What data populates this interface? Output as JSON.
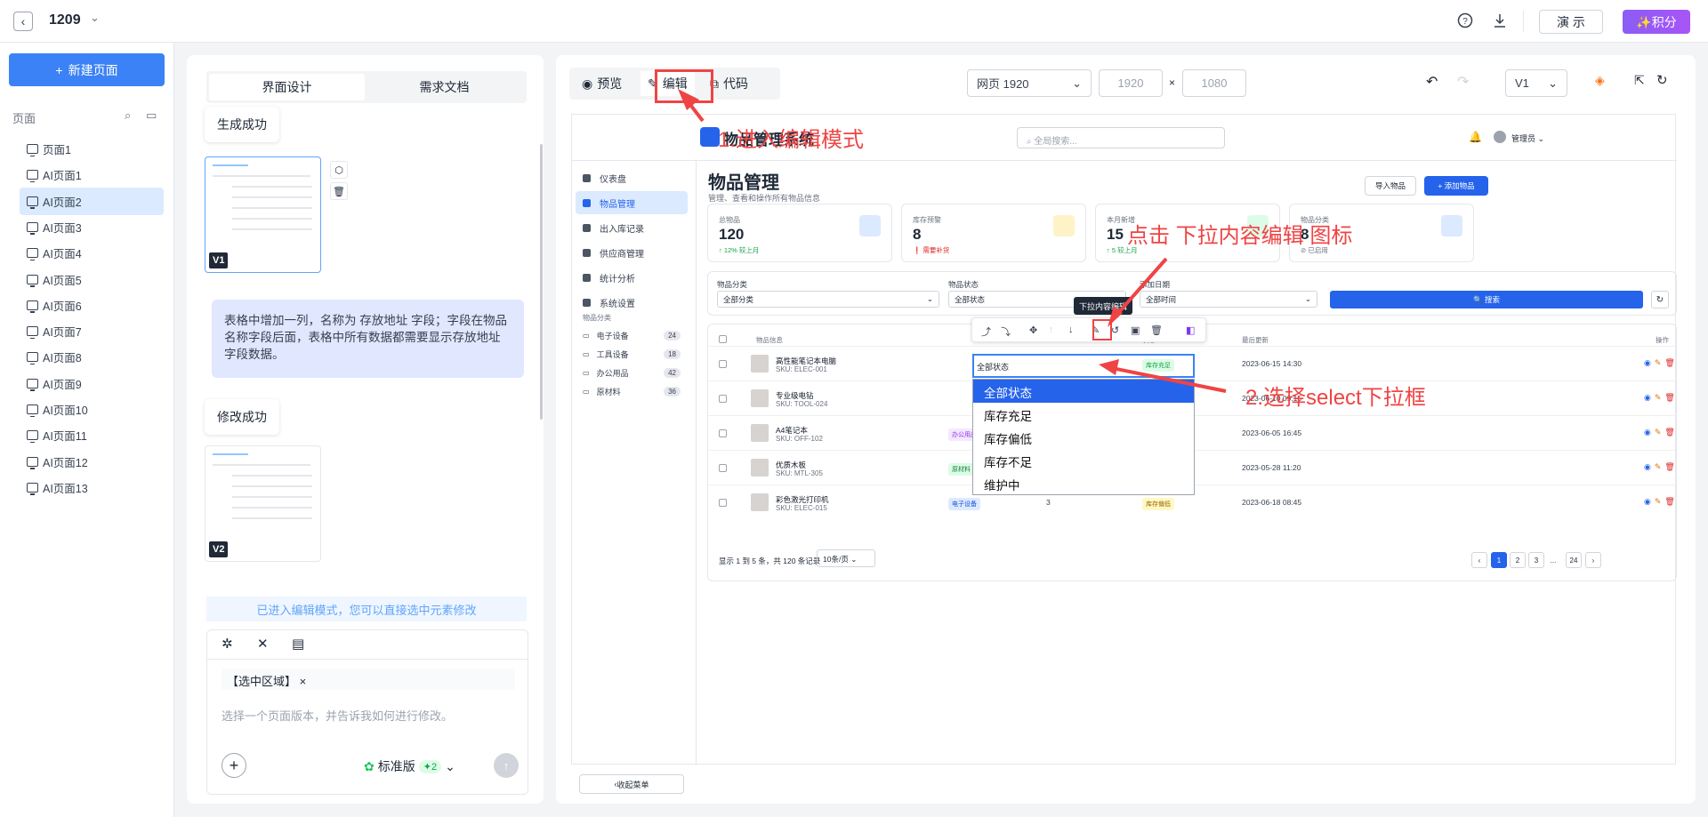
{
  "topbar": {
    "project": "1209",
    "demo": "演 示",
    "points": "✨积分"
  },
  "leftnav": {
    "new_page": "新建页面",
    "section": "页面",
    "pages": [
      "页面1",
      "AI页面1",
      "AI页面2",
      "AI页面3",
      "AI页面4",
      "AI页面5",
      "AI页面6",
      "AI页面7",
      "AI页面8",
      "AI页面9",
      "AI页面10",
      "AI页面11",
      "AI页面12",
      "AI页面13"
    ],
    "active_index": 2
  },
  "mid": {
    "tab_design": "界面设计",
    "tab_docs": "需求文档",
    "gen_success": "生成成功",
    "v1": "V1",
    "v2": "V2",
    "requirement": "表格中增加一列，名称为 存放地址 字段；字段在物品名称字段后面，表格中所有数据都需要显示存放地址字段数据。",
    "modify_success": "修改成功",
    "edit_mode_note": "已进入编辑模式，您可以直接选中元素修改",
    "chip": "【选中区域】",
    "placeholder": "选择一个页面版本，并告诉我如何进行修改。",
    "std": "标准版",
    "std_count": "2"
  },
  "canvas": {
    "preview": "预览",
    "edit": "编辑",
    "code": "代码",
    "device": "网页 1920",
    "width": "1920",
    "x": "×",
    "height": "1080",
    "version": "V1"
  },
  "app": {
    "title": "物品管理系统",
    "search": "全局搜索...",
    "user": "管理员",
    "page_title": "物品管理",
    "page_desc": "管理、查看和操作所有物品信息",
    "import": "导入物品",
    "add": "+ 添加物品",
    "nav": [
      "仪表盘",
      "物品管理",
      "出入库记录",
      "供应商管理",
      "统计分析",
      "系统设置"
    ],
    "cat_title": "物品分类",
    "cats": [
      {
        "name": "电子设备",
        "count": "24"
      },
      {
        "name": "工具设备",
        "count": "18"
      },
      {
        "name": "办公用品",
        "count": "42"
      },
      {
        "name": "原材料",
        "count": "36"
      }
    ],
    "collapse": "收起菜单",
    "stats": [
      {
        "label": "总物品",
        "value": "120",
        "sub": "↑ 12% 较上月",
        "color": "#16a34a",
        "icon": "#dbeafe"
      },
      {
        "label": "库存预警",
        "value": "8",
        "sub": "❗ 需要补货",
        "color": "#dc2626",
        "icon": "#fef3c7"
      },
      {
        "label": "本月新增",
        "value": "15",
        "sub": "↑ 5 较上月",
        "color": "#16a34a",
        "icon": "#dcfce7"
      },
      {
        "label": "物品分类",
        "value": "8",
        "sub": "⊘ 已启用",
        "color": "#6b7280",
        "icon": "#dbeafe"
      }
    ],
    "filters": {
      "cat_label": "物品分类",
      "cat_value": "全部分类",
      "status_label": "物品状态",
      "status_value": "全部状态",
      "date_label": "添加日期",
      "date_value": "全部时间",
      "search_btn": "🔍 搜索"
    },
    "headers": {
      "info": "物品信息",
      "status": "状态",
      "updated": "最后更新",
      "ops": "操作"
    },
    "rows": [
      {
        "name": "高性能笔记本电脑",
        "sku": "SKU: ELEC-001",
        "cat": "",
        "qty": "",
        "status": "库存充足",
        "date": "2023-06-15 14:30"
      },
      {
        "name": "专业级电钻",
        "sku": "SKU: TOOL-024",
        "cat": "",
        "qty": "",
        "status": "库存偏低",
        "date": "2023-06-10 09:15"
      },
      {
        "name": "A4笔记本",
        "sku": "SKU: OFF-102",
        "cat": "办公用品",
        "qty": "36",
        "status": "库存充足",
        "date": "2023-06-05 16:45"
      },
      {
        "name": "优质木板",
        "sku": "SKU: MTL-305",
        "cat": "原材料",
        "qty": "0",
        "status": "库存不足",
        "date": "2023-05-28 11:20"
      },
      {
        "name": "彩色激光打印机",
        "sku": "SKU: ELEC-015",
        "cat": "电子设备",
        "qty": "3",
        "status": "库存偏低",
        "date": "2023-06-18 08:45"
      }
    ],
    "pager_text": "显示 1 到 5 条，共 120 条记录",
    "page_size": "10条/页",
    "pages": [
      "‹",
      "1",
      "2",
      "3",
      "...",
      "24",
      "›"
    ]
  },
  "dropdown": {
    "tooltip": "下拉内容编辑",
    "options": [
      "全部状态",
      "库存充足",
      "库存偏低",
      "库存不足",
      "维护中"
    ]
  },
  "annotations": {
    "a1": "1.进入编辑模式",
    "a2": "点击 下拉内容编辑 图标",
    "a3": "2.选择select下拉框"
  },
  "colors": {
    "primary": "#2563eb",
    "annotation": "#ef4444"
  }
}
